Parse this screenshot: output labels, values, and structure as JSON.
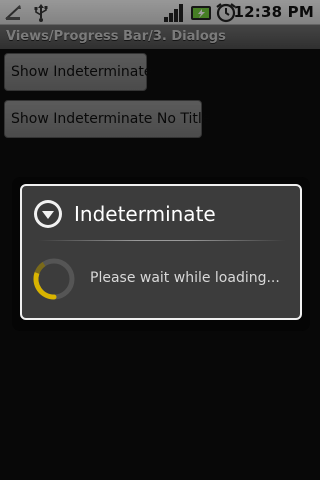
{
  "status_bar": {
    "time": "12:38 PM",
    "icons": [
      "signal-icon",
      "usb-icon",
      "cell-signal-icon",
      "battery-charging-icon",
      "alarm-icon"
    ]
  },
  "activity": {
    "title": "Views/Progress Bar/3. Dialogs"
  },
  "buttons": {
    "show_indeterminate": "Show Indeterminate",
    "show_indeterminate_no_title": "Show Indeterminate No Title"
  },
  "dialog": {
    "title": "Indeterminate",
    "message": "Please wait while loading...",
    "icon": "dialog-info-icon",
    "accent_color": "#d9b400"
  }
}
